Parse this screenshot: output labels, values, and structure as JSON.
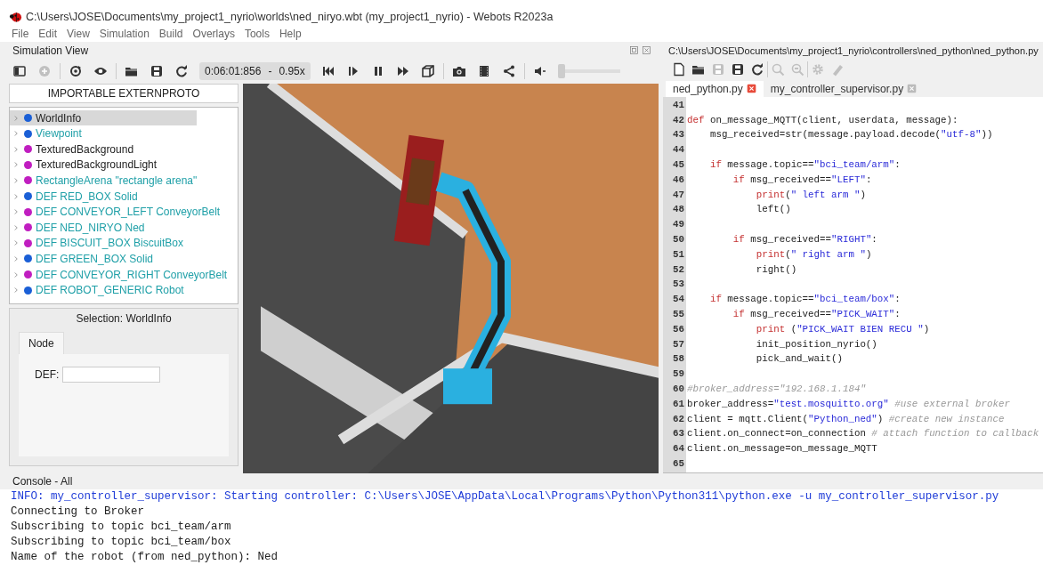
{
  "window": {
    "title": "C:\\Users\\JOSE\\Documents\\my_project1_nyrio\\worlds\\ned_niryo.wbt (my_project1_nyrio) - Webots R2023a"
  },
  "menu": [
    "File",
    "Edit",
    "View",
    "Simulation",
    "Build",
    "Overlays",
    "Tools",
    "Help"
  ],
  "simulation_view": {
    "title": "Simulation View",
    "toolbar_left": [
      {
        "disabled": false
      },
      {
        "disabled": true
      },
      {
        "disabled": false
      },
      {
        "disabled": false
      },
      {
        "disabled": false
      },
      {
        "disabled": false
      },
      {
        "disabled": false
      }
    ],
    "time": "0:06:01:856",
    "time_separator": "-",
    "speed": "0.95x",
    "toolbar_right": [
      {
        "disabled": false
      },
      {
        "disabled": false
      },
      {
        "disabled": false
      },
      {
        "disabled": false
      },
      {
        "disabled": false
      },
      {
        "disabled": false
      },
      {
        "disabled": false
      },
      {
        "disabled": false
      },
      {
        "disabled": false
      }
    ],
    "volume": {
      "level": 0
    }
  },
  "scene_tree": {
    "header": "IMPORTABLE EXTERNPROTO",
    "items": [
      {
        "label": "WorldInfo",
        "color": "#1a5fd6",
        "kind": "base",
        "selected": true
      },
      {
        "label": "Viewpoint",
        "color": "#1a5fd6",
        "kind": "modified",
        "selected": false
      },
      {
        "label": "TexturedBackground",
        "color": "#c01ec0",
        "kind": "base",
        "selected": false
      },
      {
        "label": "TexturedBackgroundLight",
        "color": "#c01ec0",
        "kind": "base",
        "selected": false
      },
      {
        "label": "RectangleArena \"rectangle arena\"",
        "color": "#c01ec0",
        "kind": "modified",
        "selected": false
      },
      {
        "label": "DEF RED_BOX Solid",
        "color": "#1a5fd6",
        "kind": "modified",
        "selected": false
      },
      {
        "label": "DEF CONVEYOR_LEFT ConveyorBelt",
        "color": "#c01ec0",
        "kind": "modified",
        "selected": false
      },
      {
        "label": "DEF NED_NIRYO Ned",
        "color": "#c01ec0",
        "kind": "modified",
        "selected": false
      },
      {
        "label": "DEF BISCUIT_BOX BiscuitBox",
        "color": "#c01ec0",
        "kind": "modified",
        "selected": false
      },
      {
        "label": "DEF GREEN_BOX Solid",
        "color": "#1a5fd6",
        "kind": "modified",
        "selected": false
      },
      {
        "label": "DEF CONVEYOR_RIGHT ConveyorBelt",
        "color": "#c01ec0",
        "kind": "modified",
        "selected": false
      },
      {
        "label": "DEF ROBOT_GENERIC Robot",
        "color": "#1a5fd6",
        "kind": "modified",
        "selected": false
      }
    ]
  },
  "selection": {
    "title": "Selection: WorldInfo",
    "tabs": [
      {
        "label": "Node",
        "selected": true
      }
    ],
    "fields": [
      {
        "label": "DEF:"
      }
    ]
  },
  "editor": {
    "path": "C:\\Users\\JOSE\\Documents\\my_project1_nyrio\\controllers\\ned_python\\ned_python.py",
    "toolbar": [
      {
        "disabled": false
      },
      {
        "disabled": false
      },
      {
        "disabled": true
      },
      {
        "disabled": false
      },
      {
        "disabled": false
      },
      {
        "disabled": true
      },
      {
        "disabled": true
      },
      {
        "disabled": true
      },
      {
        "disabled": true
      }
    ],
    "tabs": [
      {
        "label": "ned_python.py",
        "selected": true
      },
      {
        "label": "my_controller_supervisor.py",
        "selected": false
      }
    ],
    "lines": [
      {
        "number": "41"
      },
      {
        "number": "42",
        "tokens": [
          {
            "kind": "keyword",
            "text": "def"
          },
          {
            "kind": "plain",
            "text": " on_message_MQTT(client, userdata, message):"
          }
        ]
      },
      {
        "number": "43",
        "tokens": [
          {
            "kind": "plain",
            "text": "    msg_received=str(message.payload.decode("
          },
          {
            "kind": "string",
            "text": "\"utf-8\""
          },
          {
            "kind": "plain",
            "text": "))"
          }
        ]
      },
      {
        "number": "44"
      },
      {
        "number": "45",
        "tokens": [
          {
            "kind": "keyword",
            "text": "    if"
          },
          {
            "kind": "plain",
            "text": " message.topic=="
          },
          {
            "kind": "string",
            "text": "\"bci_team/arm\""
          },
          {
            "kind": "plain",
            "text": ":"
          }
        ]
      },
      {
        "number": "46",
        "tokens": [
          {
            "kind": "keyword",
            "text": "        if"
          },
          {
            "kind": "plain",
            "text": " msg_received=="
          },
          {
            "kind": "string",
            "text": "\"LEFT\""
          },
          {
            "kind": "plain",
            "text": ":"
          }
        ]
      },
      {
        "number": "47",
        "tokens": [
          {
            "kind": "keyword",
            "text": "            print"
          },
          {
            "kind": "plain",
            "text": "("
          },
          {
            "kind": "string",
            "text": "\" left arm \""
          },
          {
            "kind": "plain",
            "text": ")"
          }
        ]
      },
      {
        "number": "48",
        "tokens": [
          {
            "kind": "plain",
            "text": "            left()"
          }
        ]
      },
      {
        "number": "49"
      },
      {
        "number": "50",
        "tokens": [
          {
            "kind": "keyword",
            "text": "        if"
          },
          {
            "kind": "plain",
            "text": " msg_received=="
          },
          {
            "kind": "string",
            "text": "\"RIGHT\""
          },
          {
            "kind": "plain",
            "text": ":"
          }
        ]
      },
      {
        "number": "51",
        "tokens": [
          {
            "kind": "keyword",
            "text": "            print"
          },
          {
            "kind": "plain",
            "text": "("
          },
          {
            "kind": "string",
            "text": "\" right arm \""
          },
          {
            "kind": "plain",
            "text": ")"
          }
        ]
      },
      {
        "number": "52",
        "tokens": [
          {
            "kind": "plain",
            "text": "            right()"
          }
        ]
      },
      {
        "number": "53"
      },
      {
        "number": "54",
        "tokens": [
          {
            "kind": "keyword",
            "text": "    if"
          },
          {
            "kind": "plain",
            "text": " message.topic=="
          },
          {
            "kind": "string",
            "text": "\"bci_team/box\""
          },
          {
            "kind": "plain",
            "text": ":"
          }
        ]
      },
      {
        "number": "55",
        "tokens": [
          {
            "kind": "keyword",
            "text": "        if"
          },
          {
            "kind": "plain",
            "text": " msg_received=="
          },
          {
            "kind": "string",
            "text": "\"PICK_WAIT\""
          },
          {
            "kind": "plain",
            "text": ":"
          }
        ]
      },
      {
        "number": "56",
        "tokens": [
          {
            "kind": "keyword",
            "text": "            print"
          },
          {
            "kind": "plain",
            "text": " ("
          },
          {
            "kind": "string",
            "text": "\"PICK_WAIT BIEN RECU \""
          },
          {
            "kind": "plain",
            "text": ")"
          }
        ]
      },
      {
        "number": "57",
        "tokens": [
          {
            "kind": "plain",
            "text": "            init_position_nyrio()"
          }
        ]
      },
      {
        "number": "58",
        "tokens": [
          {
            "kind": "plain",
            "text": "            pick_and_wait()"
          }
        ]
      },
      {
        "number": "59"
      },
      {
        "number": "60",
        "tokens": [
          {
            "kind": "comment",
            "text": "#broker_address=\"192.168.1.184\""
          }
        ]
      },
      {
        "number": "61",
        "tokens": [
          {
            "kind": "plain",
            "text": "broker_address="
          },
          {
            "kind": "string",
            "text": "\"test.mosquitto.org\""
          },
          {
            "kind": "comment",
            "text": " #use external broker"
          }
        ]
      },
      {
        "number": "62",
        "tokens": [
          {
            "kind": "plain",
            "text": "client = mqtt.Client("
          },
          {
            "kind": "string",
            "text": "\"Python_ned\""
          },
          {
            "kind": "plain",
            "text": ") "
          },
          {
            "kind": "comment",
            "text": "#create new instance"
          }
        ]
      },
      {
        "number": "63",
        "tokens": [
          {
            "kind": "plain",
            "text": "client.on_connect=on_connection "
          },
          {
            "kind": "comment",
            "text": "# attach function to callback"
          }
        ]
      },
      {
        "number": "64",
        "tokens": [
          {
            "kind": "plain",
            "text": "client.on_message=on_message_MQTT"
          }
        ]
      },
      {
        "number": "65"
      }
    ]
  },
  "console": {
    "title": "Console - All",
    "lines": [
      {
        "kind": "info",
        "text": "INFO: my_controller_supervisor: Starting controller: C:\\Users\\JOSE\\AppData\\Local\\Programs\\Python\\Python311\\python.exe -u my_controller_supervisor.py"
      },
      {
        "kind": "plain",
        "text": "Connecting to Broker"
      },
      {
        "kind": "plain",
        "text": "Subscribing to topic bci_team/arm"
      },
      {
        "kind": "plain",
        "text": "Subscribing to topic bci_team/box"
      },
      {
        "kind": "plain",
        "text": "Name of the robot (from ned_python): Ned"
      }
    ]
  }
}
